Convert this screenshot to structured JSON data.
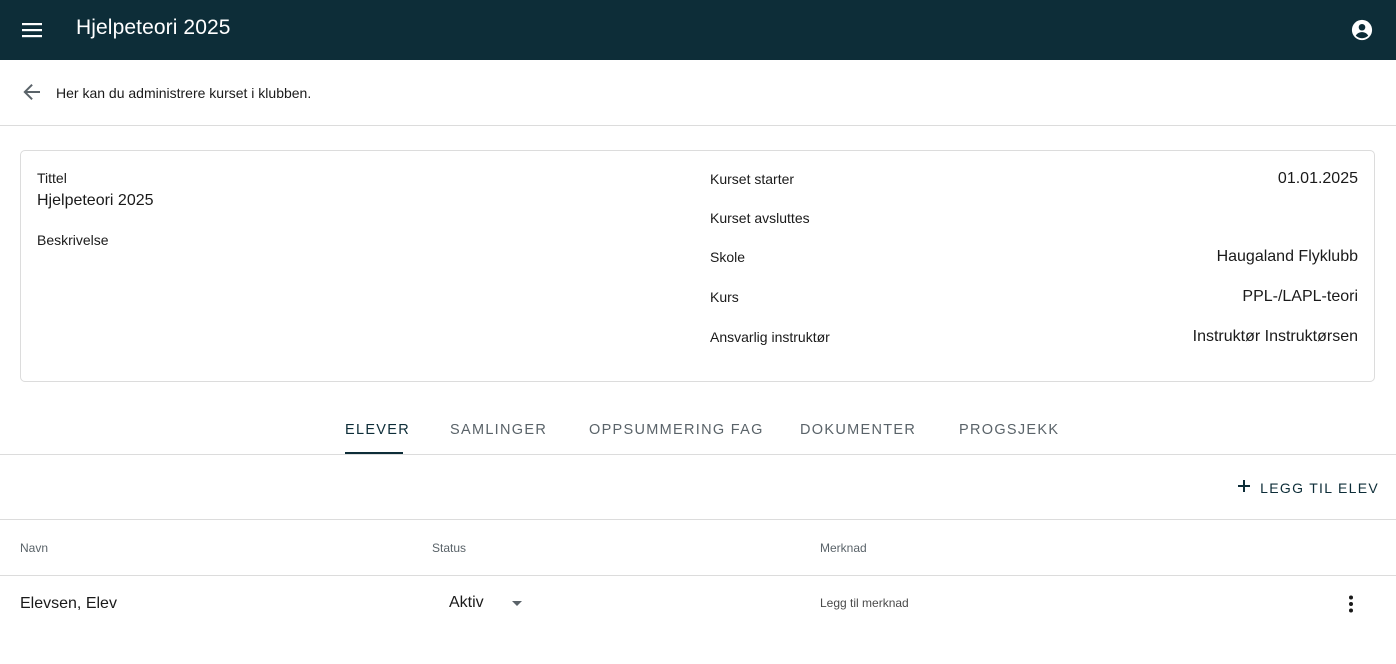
{
  "app": {
    "title": "Hjelpeteori 2025",
    "icons": {
      "menu": "hamburger-menu-icon",
      "account": "account-circle-icon"
    }
  },
  "subheader": {
    "text": "Her kan du administrere kurset i klubben.",
    "back_icon": "arrow-back-icon"
  },
  "course_card": {
    "title_label": "Tittel",
    "title_value": "Hjelpeteori 2025",
    "description_label": "Beskrivelse",
    "description_value": "",
    "fields": [
      {
        "label": "Kurset starter",
        "value": "01.01.2025"
      },
      {
        "label": "Kurset avsluttes",
        "value": ""
      },
      {
        "label": "Skole",
        "value": "Haugaland Flyklubb"
      },
      {
        "label": "Kurs",
        "value": "PPL-/LAPL-teori"
      },
      {
        "label": "Ansvarlig instruktør",
        "value": "Instruktør Instruktørsen"
      }
    ]
  },
  "tabs": [
    {
      "label": "ELEVER",
      "active": true
    },
    {
      "label": "SAMLINGER",
      "active": false
    },
    {
      "label": "OPPSUMMERING FAG",
      "active": false
    },
    {
      "label": "DOKUMENTER",
      "active": false
    },
    {
      "label": "PROGSJEKK",
      "active": false
    }
  ],
  "actions": {
    "add_student_label": "LEGG TIL ELEV",
    "add_icon": "plus-icon"
  },
  "table": {
    "columns": [
      "Navn",
      "Status",
      "Merknad"
    ],
    "rows": [
      {
        "name": "Elevsen, Elev",
        "status": "Aktiv",
        "note_placeholder": "Legg til merknad"
      }
    ]
  },
  "colors": {
    "appbar": "#0d2d38",
    "accent": "#0d2d38",
    "divider": "#dcdcdc"
  }
}
